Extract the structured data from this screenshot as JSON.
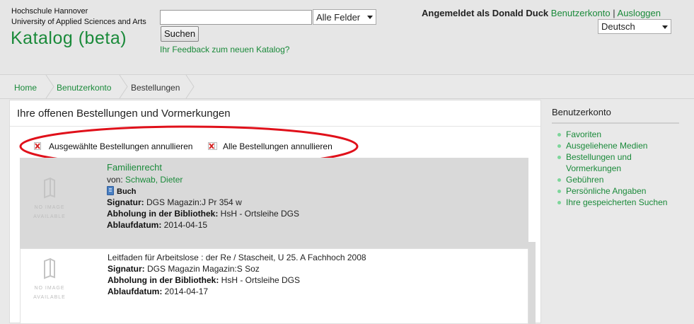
{
  "header": {
    "university_line1": "Hochschule Hannover",
    "university_line2": "University of Applied Sciences and Arts",
    "brand": "Katalog (beta)",
    "search": {
      "value": "",
      "placeholder": ""
    },
    "field_select": "Alle Felder",
    "search_button": "Suchen",
    "feedback_link": "Ihr Feedback zum neuen Katalog?",
    "logged_in_text": "Angemeldet als Donald Duck",
    "account_link": "Benutzerkonto",
    "separator": "|",
    "logout_link": "Ausloggen",
    "language": "Deutsch"
  },
  "breadcrumb": [
    "Home",
    "Benutzerkonto",
    "Bestellungen"
  ],
  "main": {
    "title": "Ihre offenen Bestellungen und Vormerkungen",
    "actions": {
      "cancel_selected": "Ausgewählte Bestellungen annullieren",
      "cancel_all": "Alle Bestellungen annullieren"
    },
    "no_image": {
      "line1": "NO IMAGE",
      "line2": "AVAILABLE"
    },
    "labels": {
      "by": "von:",
      "signature": "Signatur:",
      "pickup": "Abholung in der Bibliothek:",
      "expiry": "Ablaufdatum:"
    },
    "records": [
      {
        "title": "Familienrecht",
        "author": "Schwab, Dieter",
        "medium": "Buch",
        "signature": "DGS Magazin:J Pr 354 w",
        "pickup": "HsH - Ortsleihe DGS",
        "expiry": "2014-04-15"
      },
      {
        "title": "Leitfaden für Arbeitslose : der Re / Stascheit, U 25. A Fachhoch 2008",
        "signature": "DGS Magazin Magazin:S Soz",
        "pickup": "HsH - Ortsleihe DGS",
        "expiry": "2014-04-17"
      }
    ]
  },
  "sidebar": {
    "title": "Benutzerkonto",
    "items": [
      {
        "label": "Favoriten"
      },
      {
        "label": "Ausgeliehene Medien"
      },
      {
        "label": "Bestellungen und Vormerkungen"
      },
      {
        "label": "Gebühren"
      },
      {
        "label": "Persönliche Angaben"
      },
      {
        "label": "Ihre gespeicherten Suchen"
      }
    ]
  },
  "colors": {
    "link_green": "#1a8a3a",
    "highlight_oval": "#e0101a",
    "cancel_icon_red": "#d42020",
    "selected_record_bg": "#d9d9d9"
  },
  "icons": [
    "cancel-x-icon",
    "no-image-book-icon",
    "book-medium-icon",
    "bullet-icon"
  ]
}
